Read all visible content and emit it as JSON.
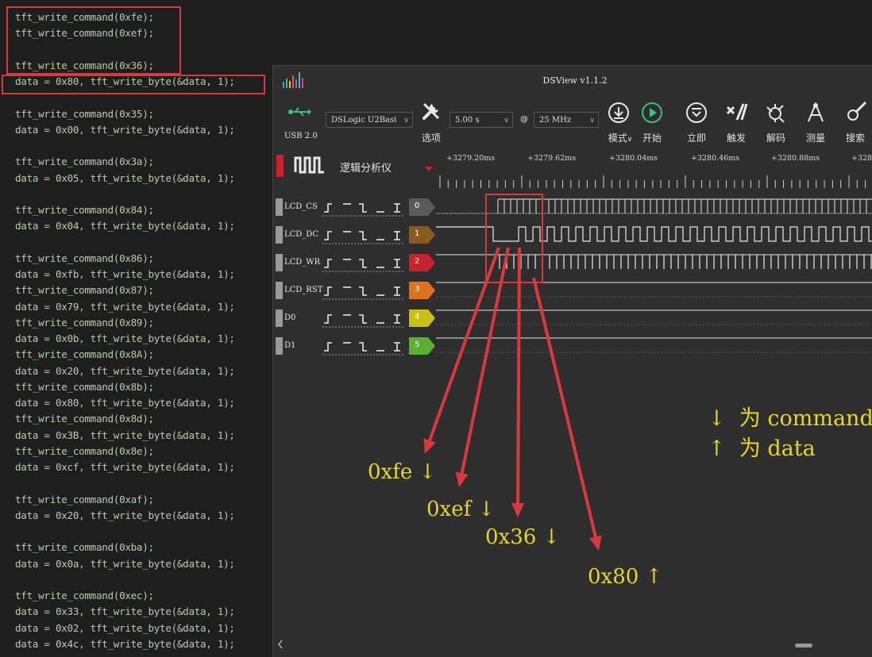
{
  "code_lines": [
    "tft_write_command(0xfe);",
    "tft_write_command(0xef);",
    "",
    "tft_write_command(0x36);",
    "data = 0x80, tft_write_byte(&data, 1);",
    "",
    "tft_write_command(0x35);",
    "data = 0x00, tft_write_byte(&data, 1);",
    "",
    "tft_write_command(0x3a);",
    "data = 0x05, tft_write_byte(&data, 1);",
    "",
    "tft_write_command(0x84);",
    "data = 0x04, tft_write_byte(&data, 1);",
    "",
    "tft_write_command(0x86);",
    "data = 0xfb, tft_write_byte(&data, 1);",
    "tft_write_command(0x87);",
    "data = 0x79, tft_write_byte(&data, 1);",
    "tft_write_command(0x89);",
    "data = 0x0b, tft_write_byte(&data, 1);",
    "tft_write_command(0x8A);",
    "data = 0x20, tft_write_byte(&data, 1);",
    "tft_write_command(0x8b);",
    "data = 0x80, tft_write_byte(&data, 1);",
    "tft_write_command(0x8d);",
    "data = 0x3B, tft_write_byte(&data, 1);",
    "tft_write_command(0x8e);",
    "data = 0xcf, tft_write_byte(&data, 1);",
    "",
    "tft_write_command(0xaf);",
    "data = 0x20, tft_write_byte(&data, 1);",
    "",
    "tft_write_command(0xba);",
    "data = 0x0a, tft_write_byte(&data, 1);",
    "",
    "tft_write_command(0xec);",
    "data = 0x33, tft_write_byte(&data, 1);",
    "data = 0x02, tft_write_byte(&data, 1);",
    "data = 0x4c, tft_write_byte(&data, 1);"
  ],
  "dsview": {
    "title": "DSView v1.1.2",
    "usb_label": "USB 2.0",
    "device": "DSLogic U2Basi",
    "options_label": "选项",
    "duration": "5.00 s",
    "at": "@",
    "rate": "25 MHz",
    "mode_label": "模式",
    "start_label": "开始",
    "instant_label": "立即",
    "trigger_label": "触发",
    "decode_label": "解码",
    "measure_label": "测量",
    "search_label": "搜索",
    "analyzer_label": "逻辑分析仪",
    "time_ticks": [
      "+3279.20ms",
      "+3279.62ms",
      "+3280.04ms",
      "+3280.46ms",
      "+3280.88ms",
      "+328"
    ],
    "channels": [
      {
        "name": "LCD_CS",
        "index": "0",
        "color": "#5a5a5a"
      },
      {
        "name": "LCD_DC",
        "index": "1",
        "color": "#8b5a1e"
      },
      {
        "name": "LCD_WR",
        "index": "2",
        "color": "#c8232c"
      },
      {
        "name": "LCD_RST",
        "index": "3",
        "color": "#e0731a"
      },
      {
        "name": "D0",
        "index": "4",
        "color": "#c8c012"
      },
      {
        "name": "D1",
        "index": "5",
        "color": "#5ab030"
      }
    ]
  },
  "annotations": {
    "a1": "0xfe ↓",
    "a2": "0xef ↓",
    "a3": "0x36 ↓",
    "a4": "0x80 ↑",
    "legend_cmd": "↓  为 command",
    "legend_data": "↑  为 data",
    "accent": "#d9393b",
    "text_color": "#e6d81c"
  }
}
